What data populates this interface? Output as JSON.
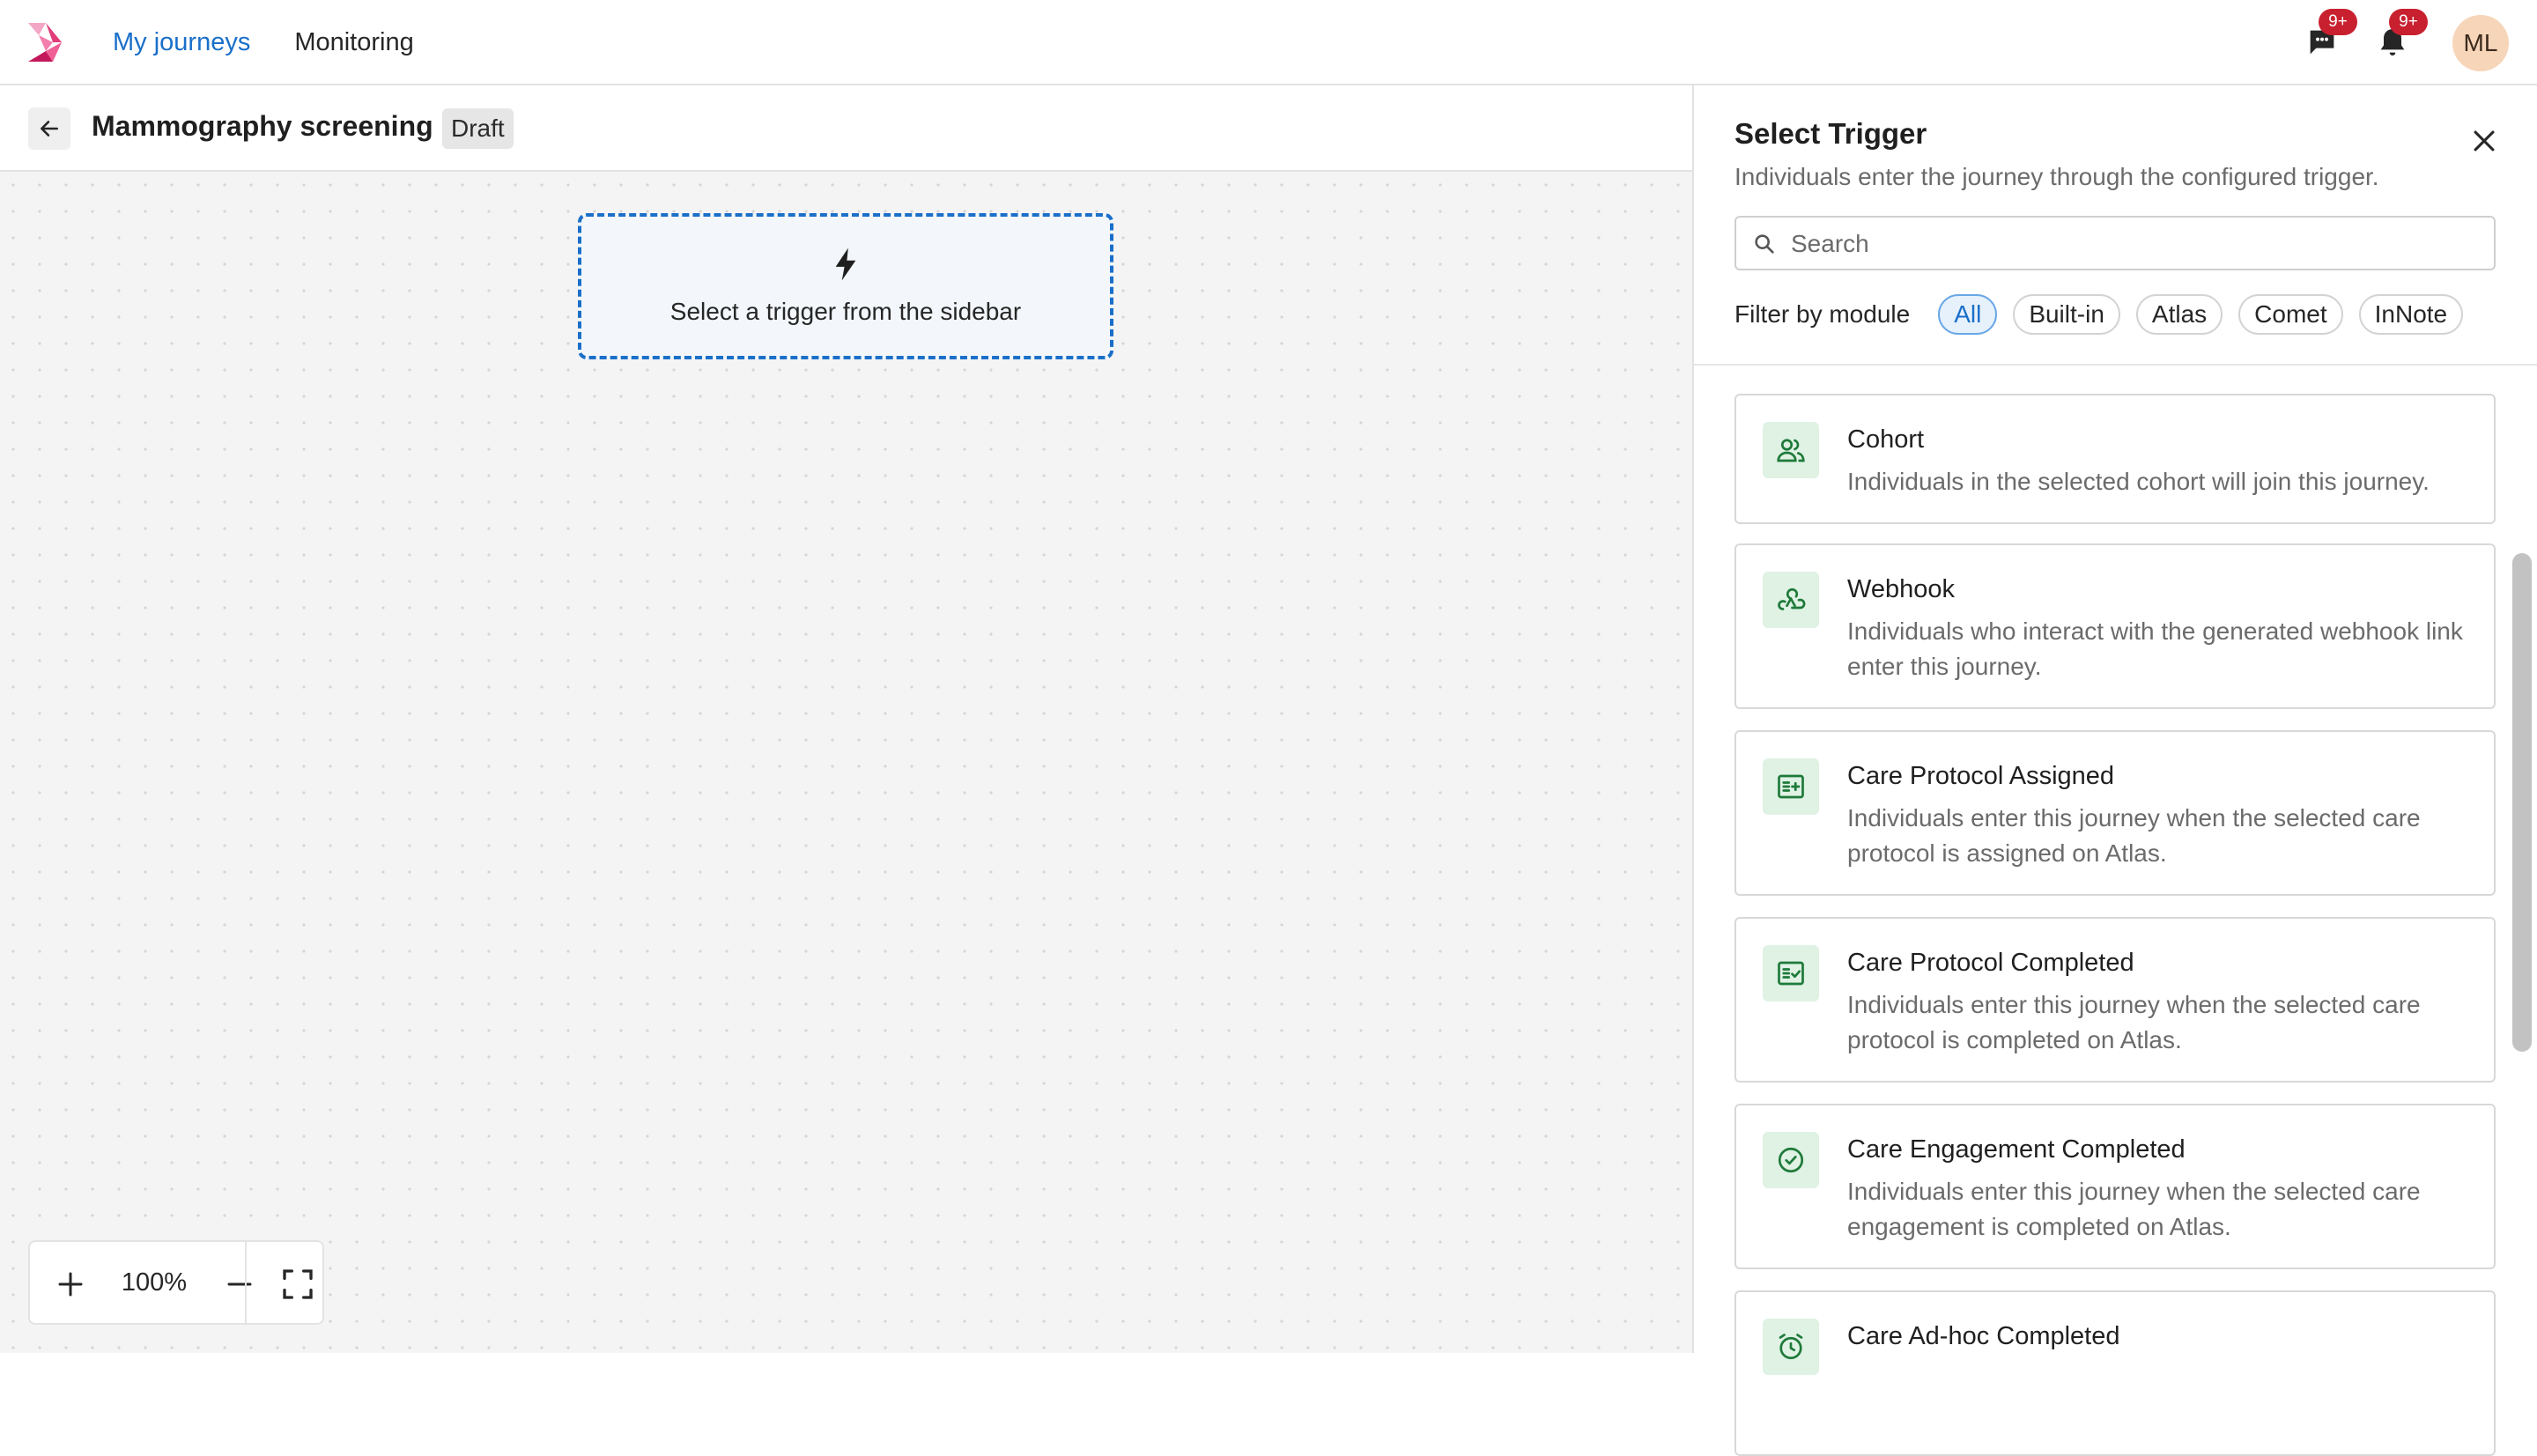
{
  "topbar": {
    "logo_name": "app-logo",
    "nav": [
      {
        "label": "My journeys",
        "active": true
      },
      {
        "label": "Monitoring",
        "active": false
      }
    ],
    "messages_badge": "9+",
    "notifications_badge": "9+",
    "avatar_initials": "ML"
  },
  "editor": {
    "title": "Mammography screening",
    "status": "Draft",
    "placeholder_text": "Select a trigger from the sidebar",
    "zoom_value": "100%"
  },
  "panel": {
    "title": "Select Trigger",
    "subtitle": "Individuals enter the journey through the configured trigger.",
    "search_placeholder": "Search",
    "filter_label": "Filter by module",
    "filters": [
      "All",
      "Built-in",
      "Atlas",
      "Comet",
      "InNote"
    ],
    "active_filter": "All",
    "triggers": [
      {
        "name": "Cohort",
        "description": "Individuals in the selected cohort will join this journey.",
        "icon": "users-icon"
      },
      {
        "name": "Webhook",
        "description": "Individuals who interact with the generated webhook link enter this journey.",
        "icon": "webhook-icon"
      },
      {
        "name": "Care Protocol Assigned",
        "description": "Individuals enter this journey when the selected care protocol is assigned on Atlas.",
        "icon": "protocol-add-icon"
      },
      {
        "name": "Care Protocol Completed",
        "description": "Individuals enter this journey when the selected care protocol is completed on Atlas.",
        "icon": "protocol-check-icon"
      },
      {
        "name": "Care Engagement Completed",
        "description": "Individuals enter this journey when the selected care engagement is completed on Atlas.",
        "icon": "check-circle-icon"
      },
      {
        "name": "Care Ad-hoc Completed",
        "description": "",
        "icon": "alarm-icon"
      }
    ]
  },
  "colors": {
    "accent": "#1a6fc9",
    "badge": "#c8202f",
    "icon_tile": "#dff2e4",
    "icon_stroke": "#1f7a3a"
  }
}
